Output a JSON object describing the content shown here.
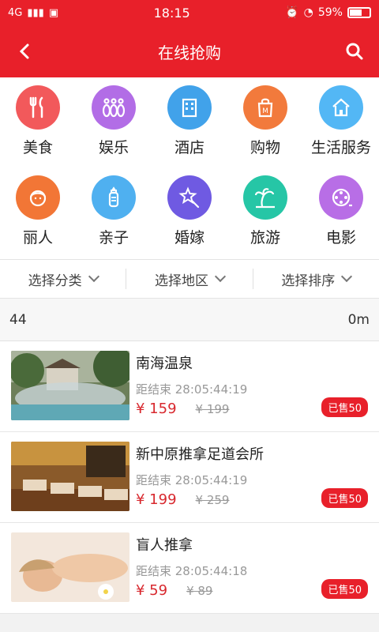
{
  "status": {
    "network": "4G",
    "time": "18:15",
    "battery": "59%"
  },
  "header": {
    "title": "在线抢购"
  },
  "categories": [
    {
      "label": "美食",
      "icon": "fork-knife-icon",
      "color": "#f2595b"
    },
    {
      "label": "娱乐",
      "icon": "bowling-pins-icon",
      "color": "#b26de6"
    },
    {
      "label": "酒店",
      "icon": "building-icon",
      "color": "#41a2ea"
    },
    {
      "label": "购物",
      "icon": "shopping-bag-icon",
      "color": "#f27a3c"
    },
    {
      "label": "生活服务",
      "icon": "home-icon",
      "color": "#53b7f5"
    },
    {
      "label": "丽人",
      "icon": "woman-face-icon",
      "color": "#f27636"
    },
    {
      "label": "亲子",
      "icon": "baby-bottle-icon",
      "color": "#4fb0f0"
    },
    {
      "label": "婚嫁",
      "icon": "star-wand-icon",
      "color": "#6f5ae2"
    },
    {
      "label": "旅游",
      "icon": "palm-tree-icon",
      "color": "#26c6a6"
    },
    {
      "label": "电影",
      "icon": "film-reel-icon",
      "color": "#b86ee6"
    }
  ],
  "filters": [
    "选择分类",
    "选择地区",
    "选择排序"
  ],
  "info": {
    "left": "44",
    "right": "0m"
  },
  "deals": [
    {
      "name": "南海温泉",
      "timer": "距结束 28:05:44:19",
      "price": "¥ 159",
      "old": "¥ 199",
      "sold": "已售50"
    },
    {
      "name": "新中原推拿足道会所",
      "timer": "距结束 28:05:44:19",
      "price": "¥ 199",
      "old": "¥ 259",
      "sold": "已售50"
    },
    {
      "name": "盲人推拿",
      "timer": "距结束 28:05:44:18",
      "price": "¥ 59",
      "old": "¥ 89",
      "sold": "已售50"
    }
  ]
}
